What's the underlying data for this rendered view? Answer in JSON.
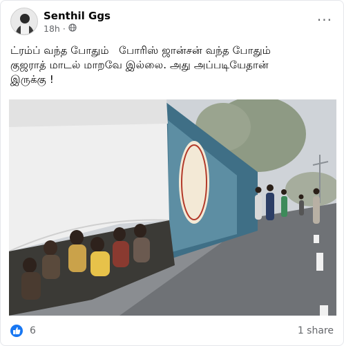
{
  "post": {
    "author": "Senthil Ggs",
    "time": "18h",
    "separator": "·",
    "more_label": "···",
    "text_line1": "ட்ரம்ப் வந்த போதும்   போரிஸ் ஜான்சன் வந்த போதும்",
    "text_line2": "குஜராத் மாடல் மாறவே இல்லை. அது அப்படியேதான்",
    "text_line3": "இருக்கு !"
  },
  "reactions": {
    "like_count": "6",
    "shares": "1 share"
  },
  "icons": {
    "audience": "globe-icon",
    "reaction": "like-icon",
    "menu": "more-options-icon"
  },
  "colors": {
    "accent": "#1877f2",
    "secondary_text": "#65676b"
  }
}
